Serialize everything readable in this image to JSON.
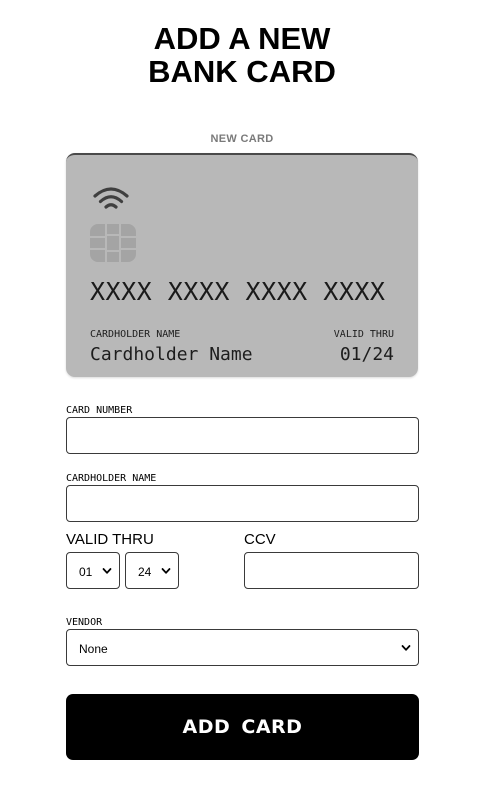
{
  "page": {
    "title_line1": "ADD A NEW",
    "title_line2": "BANK CARD"
  },
  "preview": {
    "label": "NEW CARD",
    "number": "XXXX XXXX XXXX XXXX",
    "holder_label": "CARDHOLDER NAME",
    "holder_value": "Cardholder Name",
    "valid_label": "VALID THRU",
    "valid_value": "01/24",
    "background_color": "#b8b8b8",
    "icons": [
      "wifi-icon",
      "chip-icon"
    ]
  },
  "form": {
    "card_number_label": "CARD NUMBER",
    "card_number_value": "",
    "cardholder_label": "CARDHOLDER NAME",
    "cardholder_value": "",
    "valid_thru_label": "VALID THRU",
    "month_value": "01",
    "year_value": "24",
    "ccv_label": "CCV",
    "ccv_value": "",
    "vendor_label": "VENDOR",
    "vendor_value": "None"
  },
  "actions": {
    "add_card_label": "ADD CARD",
    "button_color": "#000000"
  }
}
